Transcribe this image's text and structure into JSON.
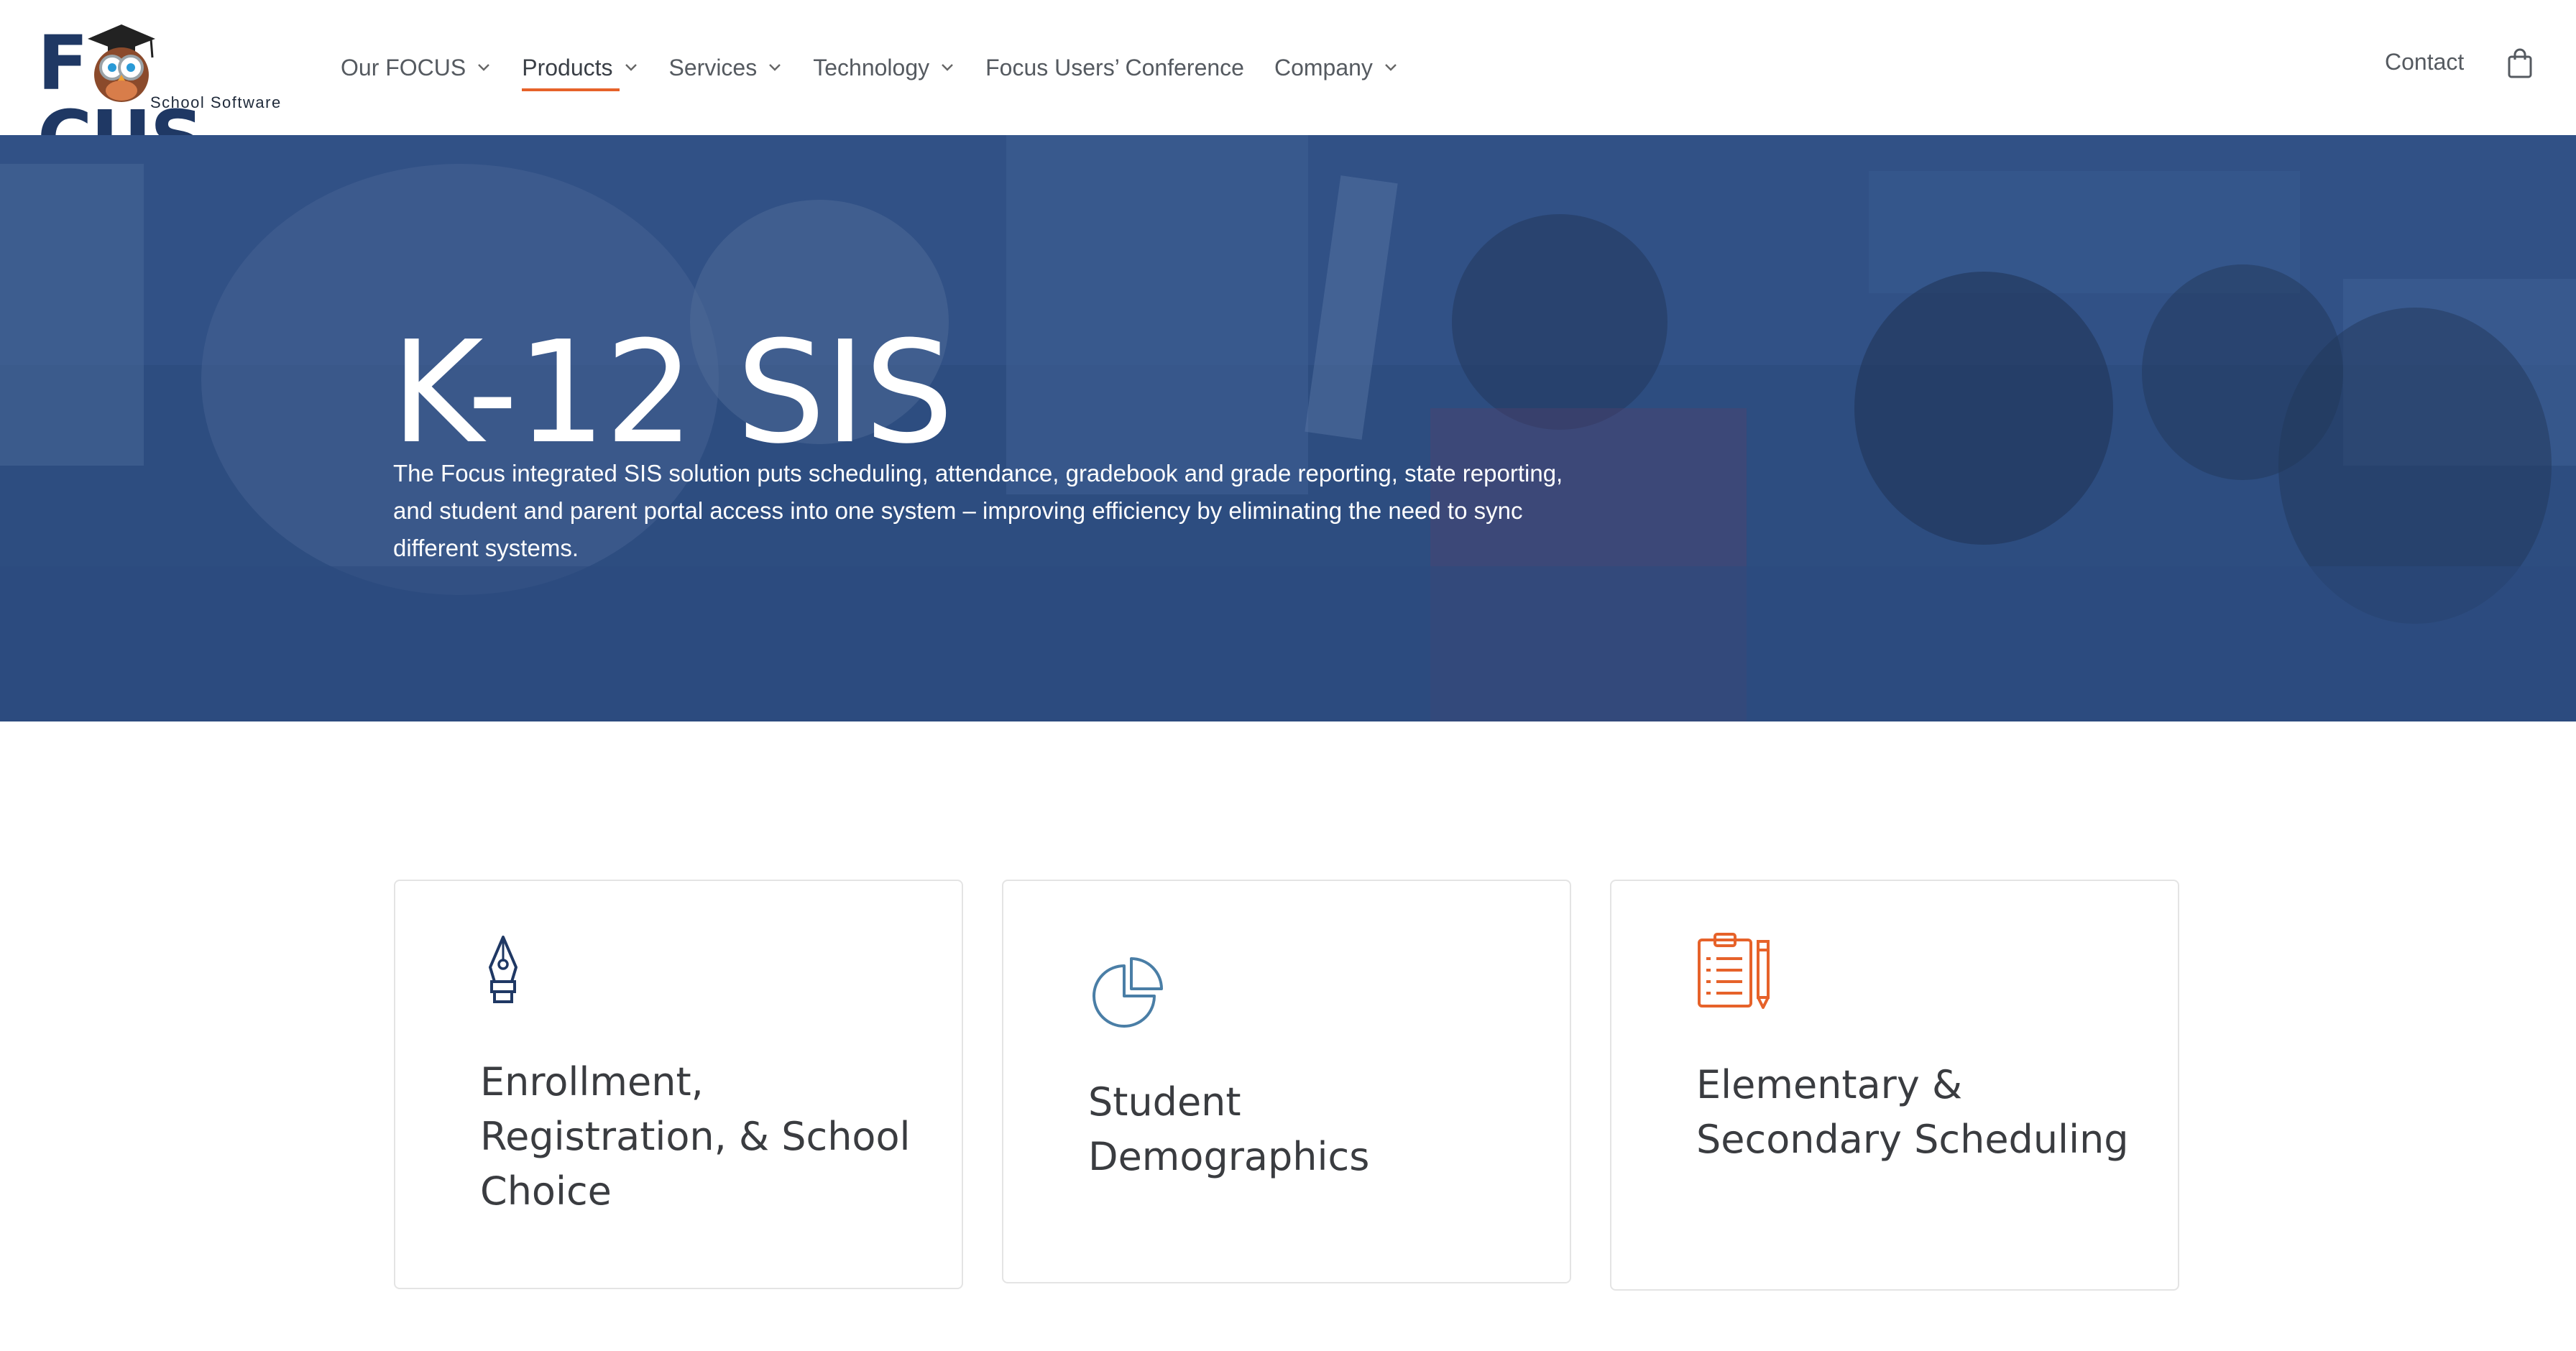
{
  "brand": {
    "name_left": "F",
    "name_right": "CUS",
    "tagline": "School Software"
  },
  "nav": {
    "items": [
      {
        "label": "Our FOCUS"
      },
      {
        "label": "Products"
      },
      {
        "label": "Services"
      },
      {
        "label": "Technology"
      },
      {
        "label": "Focus Users’ Conference"
      },
      {
        "label": "Company"
      }
    ],
    "contact": "Contact"
  },
  "hero": {
    "title": "K-12 SIS",
    "description": "The Focus integrated SIS solution puts scheduling, attendance, gradebook and grade reporting, state reporting, and student and parent portal access into one system – improving efficiency by eliminating the need to sync different systems."
  },
  "cards": [
    {
      "title": "Enrollment, Registration, & School Choice",
      "icon": "pen-nib-icon",
      "color": "#1f3864"
    },
    {
      "title": "Student Demographics",
      "icon": "pie-chart-icon",
      "color": "#4a7ea6"
    },
    {
      "title": "Elementary & Secondary Scheduling",
      "icon": "clipboard-icon",
      "color": "#e6622a"
    }
  ],
  "colors": {
    "brand_navy": "#1f3864",
    "accent_orange": "#e6622a",
    "hero_overlay": "#2e4f82"
  }
}
